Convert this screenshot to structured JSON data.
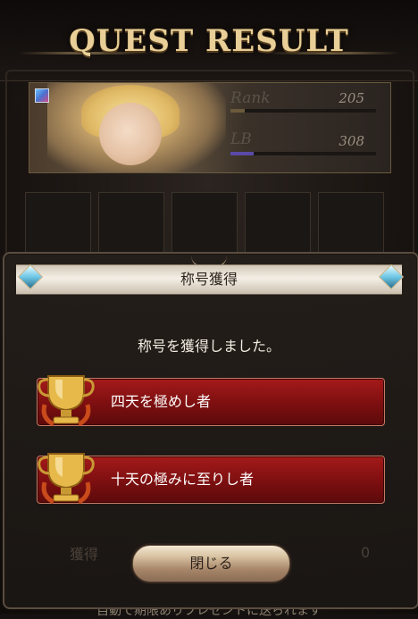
{
  "header": {
    "title": "QUEST RESULT"
  },
  "character": {
    "rank_label": "Rank",
    "rank_value": "205",
    "rank_progress": 0.1,
    "lb_label": "LB",
    "lb_value": "308",
    "lb_progress": 0.16
  },
  "modal": {
    "title": "称号獲得",
    "message": "称号を獲得しました。",
    "titles": [
      {
        "label": "四天を極めし者",
        "icon": "gold-trophy-icon"
      },
      {
        "label": "十天の極みに至りし者",
        "icon": "gold-trophy-icon"
      }
    ],
    "close_label": "閉じる"
  },
  "background": {
    "partial_label": "獲得",
    "bottom_note": "自動で期限ありプレゼントに送られます",
    "partial_value": "0"
  },
  "colors": {
    "accent_red": "#8a1414",
    "gold": "#e9cf97",
    "rank_bar": "#6b5a3a",
    "lb_bar": "#5a4aa8"
  }
}
